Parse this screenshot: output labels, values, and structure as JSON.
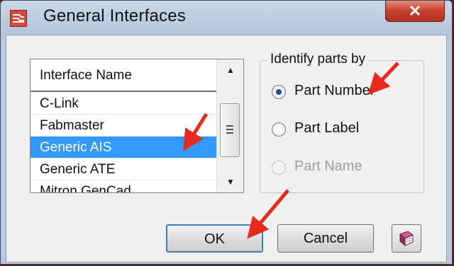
{
  "window": {
    "title": "General Interfaces",
    "close_symbol": "✕"
  },
  "list": {
    "header": "Interface Name",
    "items": [
      "C-Link",
      "Fabmaster",
      "Generic AIS",
      "Generic ATE",
      "Mitron GenCad"
    ],
    "selected": "Generic AIS"
  },
  "identify": {
    "legend": "Identify parts by",
    "options": [
      {
        "label": "Part Number",
        "checked": true,
        "enabled": true
      },
      {
        "label": "Part Label",
        "checked": false,
        "enabled": true
      },
      {
        "label": "Part Name",
        "checked": false,
        "enabled": false
      }
    ]
  },
  "buttons": {
    "ok": "OK",
    "cancel": "Cancel"
  },
  "colors": {
    "selection": "#3399ff",
    "annotation": "#e8291c",
    "close": "#c7402e"
  }
}
